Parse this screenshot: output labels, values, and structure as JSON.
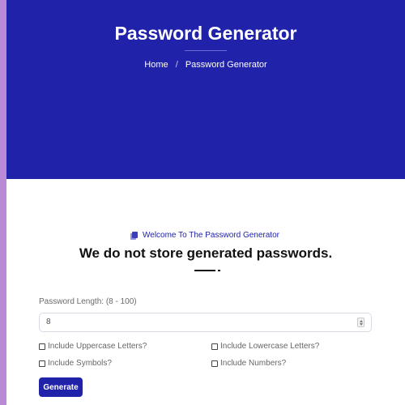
{
  "hero": {
    "title": "Password Generator",
    "breadcrumb": {
      "home": "Home",
      "separator": "/",
      "current": "Password Generator"
    },
    "background_color": "#2022aa"
  },
  "main": {
    "welcome": "Welcome To The Password Generator",
    "subtitle": "We do not store generated passwords.",
    "length_label": "Password Length: (8 - 100)",
    "length_value": "8",
    "options": {
      "uppercase": "Include Uppercase Letters?",
      "lowercase": "Include Lowercase Letters?",
      "symbols": "Include Symbols?",
      "numbers": "Include Numbers?"
    },
    "generate_label": "Generate",
    "accent_color": "#2022aa"
  }
}
